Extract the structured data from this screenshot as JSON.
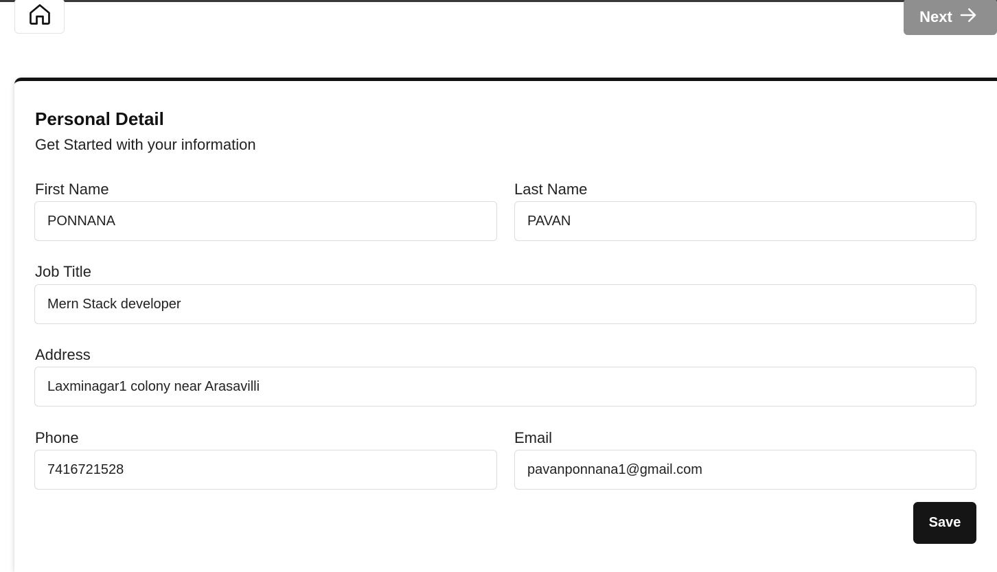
{
  "nav": {
    "home_icon": "home-icon",
    "next_label": "Next",
    "next_icon": "arrow-right-icon",
    "next_color": "#8f8f8f"
  },
  "form": {
    "title": "Personal Detail",
    "subtitle": "Get Started with your information",
    "first_name": {
      "label": "First Name",
      "value": "PONNANA"
    },
    "last_name": {
      "label": "Last Name",
      "value": "PAVAN"
    },
    "job_title": {
      "label": "Job Title",
      "value": "Mern Stack developer"
    },
    "address": {
      "label": "Address",
      "value": "Laxminagar1 colony near Arasavilli"
    },
    "phone": {
      "label": "Phone",
      "value": "7416721528"
    },
    "email": {
      "label": "Email",
      "value": "pavanponnana1@gmail.com"
    },
    "save_label": "Save"
  },
  "colors": {
    "accent": "#111111",
    "save_button": "#151515"
  }
}
